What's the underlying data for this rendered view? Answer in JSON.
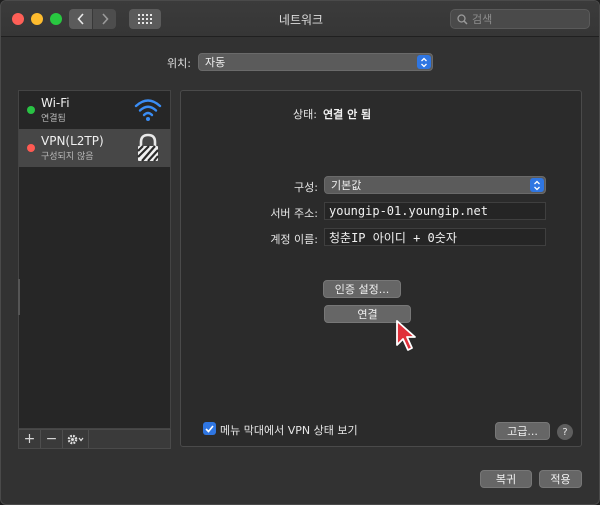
{
  "window": {
    "title": "네트워크",
    "search_placeholder": "검색"
  },
  "location": {
    "label": "위치:",
    "value": "자동"
  },
  "services": [
    {
      "name": "Wi-Fi",
      "status": "연결됨",
      "status_color": "#29c244",
      "icon": "wifi-icon"
    },
    {
      "name": "VPN(L2TP)",
      "status": "구성되지 않음",
      "status_color": "#ff5a52",
      "icon": "lock-icon"
    }
  ],
  "list_tools": {
    "add": "+",
    "remove": "−"
  },
  "detail": {
    "status_label": "상태:",
    "status_value": "연결 안 됨",
    "config_label": "구성:",
    "config_value": "기본값",
    "server_label": "서버 주소:",
    "server_value": "youngip-01.youngip.net",
    "account_label": "계정 이름:",
    "account_value": "청춘IP 아이디 + 0숫자",
    "auth_button": "인증 설정...",
    "connect_button": "연결",
    "show_status_label": "메뉴 막대에서 VPN 상태 보기",
    "show_status_checked": true,
    "advanced_button": "고급...",
    "help_button": "?"
  },
  "footer": {
    "revert_button": "복귀",
    "apply_button": "적용"
  },
  "colors": {
    "accent": "#2f76e2",
    "connected": "#29c244",
    "disconnected": "#ff5a52"
  }
}
